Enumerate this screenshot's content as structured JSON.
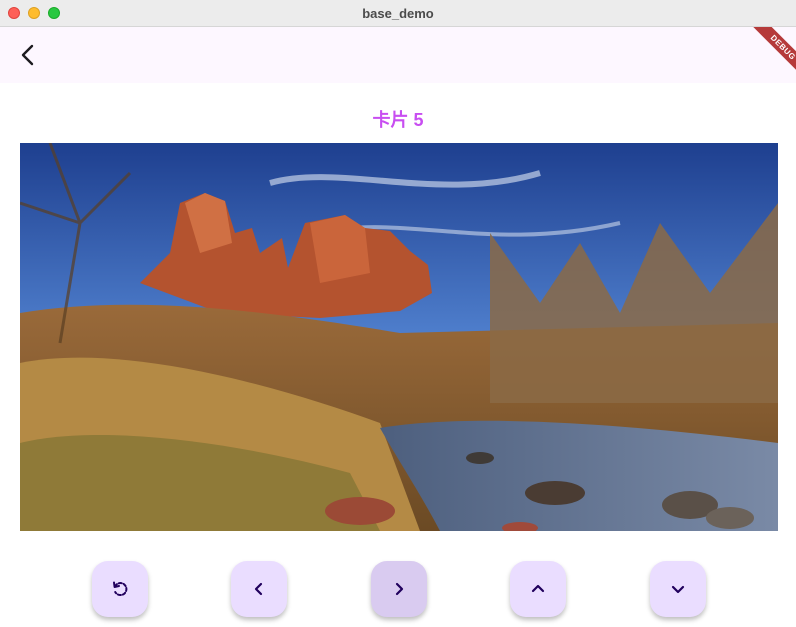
{
  "window": {
    "title": "base_demo"
  },
  "appbar": {
    "back_icon": "arrow-back-icon",
    "debug_banner": "DEBUG"
  },
  "card": {
    "title": "卡片 5"
  },
  "controls": [
    {
      "icon": "refresh-icon"
    },
    {
      "icon": "chevron-left-icon"
    },
    {
      "icon": "chevron-right-icon"
    },
    {
      "icon": "chevron-up-icon"
    },
    {
      "icon": "chevron-down-icon"
    }
  ],
  "colors": {
    "accent": "#c84ef1",
    "button_bg": "#eaddff",
    "appbar_bg": "#fdf7ff",
    "debug_banner": "#b53a3a"
  }
}
